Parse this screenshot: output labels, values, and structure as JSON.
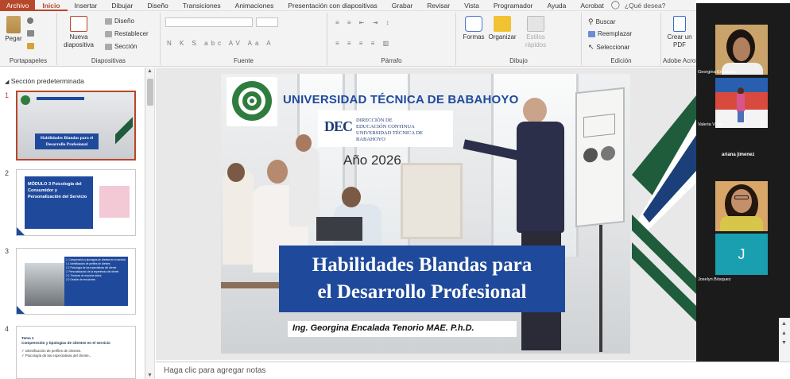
{
  "tabs": [
    "Archivo",
    "Inicio",
    "Insertar",
    "Dibujar",
    "Diseño",
    "Transiciones",
    "Animaciones",
    "Presentación con diapositivas",
    "Grabar",
    "Revisar",
    "Vista",
    "Programador",
    "Ayuda",
    "Acrobat"
  ],
  "active_tab": "Inicio",
  "tell_me": "¿Qué desea?",
  "ribbon": {
    "portapapeles": {
      "label": "Portapapeles",
      "paste": "Pegar"
    },
    "diapositivas": {
      "label": "Diapositivas",
      "new_slide": "Nueva diapositiva",
      "layout": "Diseño",
      "reset": "Restablecer",
      "section": "Sección"
    },
    "fuente": {
      "label": "Fuente"
    },
    "parrafo": {
      "label": "Párrafo"
    },
    "dibujo": {
      "label": "Dibujo",
      "shapes": "Formas",
      "arrange": "Organizar",
      "quick_styles": "Estilos rápidos"
    },
    "edicion": {
      "label": "Edición",
      "find": "Buscar",
      "replace": "Reemplazar",
      "select": "Seleccionar"
    },
    "acrobat": {
      "label": "Adobe Acrobat",
      "create_pdf": "Crear un PDF"
    }
  },
  "slides_panel": {
    "section": "Sección predeterminada",
    "numbers": [
      "1",
      "2",
      "3",
      "4"
    ],
    "thumb1_title": "Habilidades Blandas para el Desarrollo Profesional",
    "thumb2_title": "MÓDULO 3 Psicología del Consumidor y Personalización del Servicio",
    "thumb3_items": [
      "1. Comprensión y tipologías de clientes en el servicio",
      "1.1 Identificación de perfiles de clientes",
      "1.2 Psicología de las expectativas del cliente",
      "2. Personalización de la experiencia del cliente",
      "2.1 Técnicas de escucha activa",
      "2.2 Gestión de emociones"
    ],
    "thumb4_title": "Tema 1\nComprensión y tipologías de clientes en el servicio",
    "thumb4_items": [
      "✓ Identificación de perfiles de clientes.",
      "✓ Psicología de las expectativas del cliente..."
    ]
  },
  "slide": {
    "university": "UNIVERSIDAD TÉCNICA DE BABAHOYO",
    "dec_mark": "DEC",
    "dec_text": "DIRECCIÓN DE\nEDUCACIÓN CONTINUA\nUNIVERSIDAD TÉCNICA DE BABAHOYO",
    "year": "Año 2026",
    "title": "Habilidades Blandas para\nel Desarrollo Profesional",
    "author": "Ing. Georgina Encalada Tenorio MAE.  P.h.D."
  },
  "notes_placeholder": "Haga clic para agregar notas",
  "participants": [
    {
      "name": "Georgina Encalada"
    },
    {
      "name": "Valeria Vera"
    },
    {
      "name": "ariana jimenez"
    },
    {
      "name": "Joselyn Bósquez",
      "initial": "J"
    }
  ],
  "colors": {
    "accent": "#b7472a",
    "brand_blue": "#1f4a9c",
    "teams_tile": "#1a9fb0",
    "deco_green": "#1f5c3c"
  }
}
